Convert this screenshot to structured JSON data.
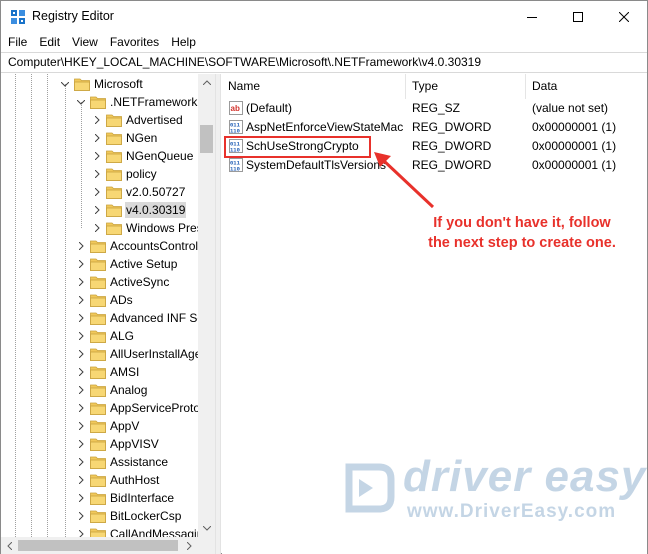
{
  "window": {
    "title": "Registry Editor",
    "controls": {
      "minimize": "minimize",
      "maximize": "maximize",
      "close": "close"
    }
  },
  "menu": {
    "items": [
      "File",
      "Edit",
      "View",
      "Favorites",
      "Help"
    ]
  },
  "address": {
    "path": "Computer\\HKEY_LOCAL_MACHINE\\SOFTWARE\\Microsoft\\.NETFramework\\v4.0.30319"
  },
  "tree": {
    "items": [
      {
        "label": "Microsoft",
        "expanded": true
      },
      {
        "label": ".NETFramework",
        "expanded": true
      },
      {
        "label": "Advertised",
        "expanded": false
      },
      {
        "label": "NGen",
        "expanded": false
      },
      {
        "label": "NGenQueue",
        "expanded": false
      },
      {
        "label": "policy",
        "expanded": false
      },
      {
        "label": "v2.0.50727",
        "expanded": false
      },
      {
        "label": "v4.0.30319",
        "expanded": false,
        "selected": true
      },
      {
        "label": "Windows Presentation Foundation",
        "expanded": false
      },
      {
        "label": "AccountsControl",
        "expanded": false
      },
      {
        "label": "Active Setup",
        "expanded": false
      },
      {
        "label": "ActiveSync",
        "expanded": false
      },
      {
        "label": "ADs",
        "expanded": false
      },
      {
        "label": "Advanced INF Setup",
        "expanded": false
      },
      {
        "label": "ALG",
        "expanded": false
      },
      {
        "label": "AllUserInstallAgent",
        "expanded": false
      },
      {
        "label": "AMSI",
        "expanded": false
      },
      {
        "label": "Analog",
        "expanded": false
      },
      {
        "label": "AppServiceProtocols",
        "expanded": false
      },
      {
        "label": "AppV",
        "expanded": false
      },
      {
        "label": "AppVISV",
        "expanded": false
      },
      {
        "label": "Assistance",
        "expanded": false
      },
      {
        "label": "AuthHost",
        "expanded": false
      },
      {
        "label": "BidInterface",
        "expanded": false
      },
      {
        "label": "BitLockerCsp",
        "expanded": false
      },
      {
        "label": "CallAndMessagingEnhancement",
        "expanded": false
      }
    ]
  },
  "values": {
    "columns": {
      "name": "Name",
      "type": "Type",
      "data": "Data"
    },
    "rows": [
      {
        "name": "(Default)",
        "type": "REG_SZ",
        "data": "(value not set)",
        "icon": "string-value-icon"
      },
      {
        "name": "AspNetEnforceViewStateMac",
        "type": "REG_DWORD",
        "data": "0x00000001 (1)",
        "icon": "dword-value-icon"
      },
      {
        "name": "SchUseStrongCrypto",
        "type": "REG_DWORD",
        "data": "0x00000001 (1)",
        "icon": "dword-value-icon"
      },
      {
        "name": "SystemDefaultTlsVersions",
        "type": "REG_DWORD",
        "data": "0x00000001 (1)",
        "icon": "dword-value-icon"
      }
    ]
  },
  "annotation": {
    "line1": "If you don't have it, follow",
    "line2": "the next step to create one.",
    "color": "#e8312b"
  },
  "watermark": {
    "brand": "driver easy",
    "url": "www.DriverEasy.com"
  },
  "colors": {
    "folder": "#f0c85a",
    "selection": "#d9d9d9",
    "accent_red": "#e8312b",
    "watermark_blue": "#4a7fb0"
  }
}
